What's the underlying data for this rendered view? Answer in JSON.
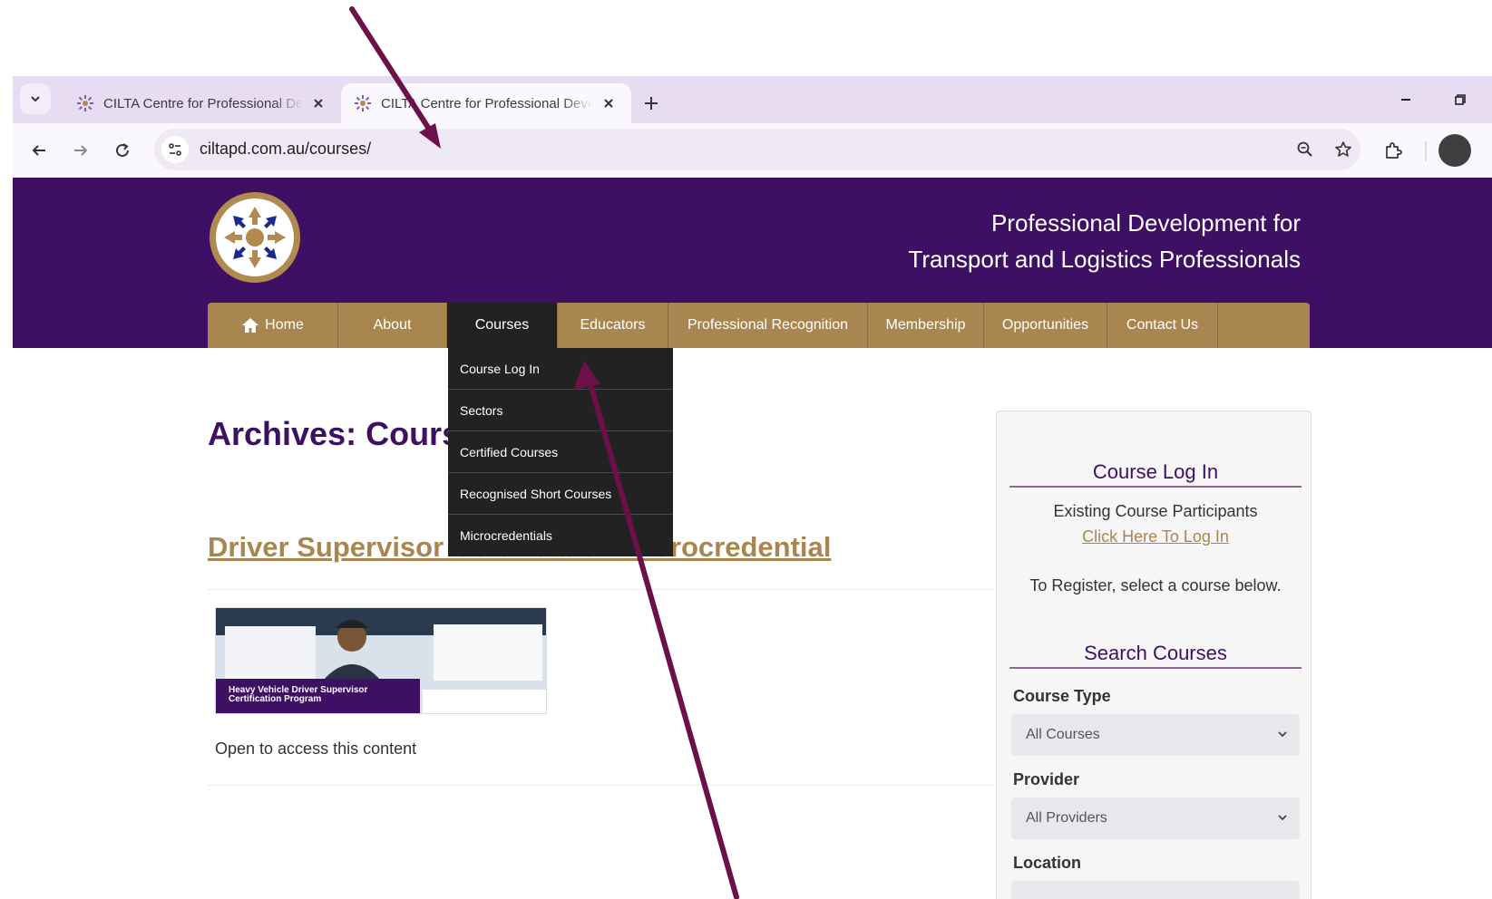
{
  "browser": {
    "tabs": [
      {
        "title": "CILTA Centre for Professional Development",
        "active": false
      },
      {
        "title": "CILTA Centre for Professional Development",
        "active": true
      }
    ],
    "url": "ciltapd.com.au/courses/"
  },
  "site": {
    "tagline_line1": "Professional Development for",
    "tagline_line2": "Transport and Logistics Professionals",
    "nav": [
      {
        "label": "Home"
      },
      {
        "label": "About"
      },
      {
        "label": "Courses"
      },
      {
        "label": "Educators"
      },
      {
        "label": "Professional Recognition"
      },
      {
        "label": "Membership"
      },
      {
        "label": "Opportunities"
      },
      {
        "label": "Contact Us"
      }
    ],
    "courses_menu": [
      "Course Log In",
      "Sectors",
      "Certified Courses",
      "Recognised Short Courses",
      "Microcredentials"
    ]
  },
  "main": {
    "archive_title": "Archives: Courses",
    "post_title": "Driver Supervisor Certification Microcredential",
    "thumb_banner_line1": "Heavy Vehicle Driver Supervisor",
    "thumb_banner_line2": "Certification Program",
    "excerpt": "Open to access this content"
  },
  "sidebar": {
    "login_heading": "Course Log In",
    "existing": "Existing Course Participants",
    "login_link": "Click Here To Log In",
    "register": "To Register, select a course below.",
    "search_heading": "Search Courses",
    "course_type_label": "Course Type",
    "course_type_value": "All Courses",
    "provider_label": "Provider",
    "provider_value": "All Providers",
    "location_label": "Location"
  },
  "colors": {
    "brand_purple": "#3d1063",
    "brand_gold": "#a98650",
    "dropdown_bg": "#222222",
    "annotation_arrow": "#6b1049"
  }
}
